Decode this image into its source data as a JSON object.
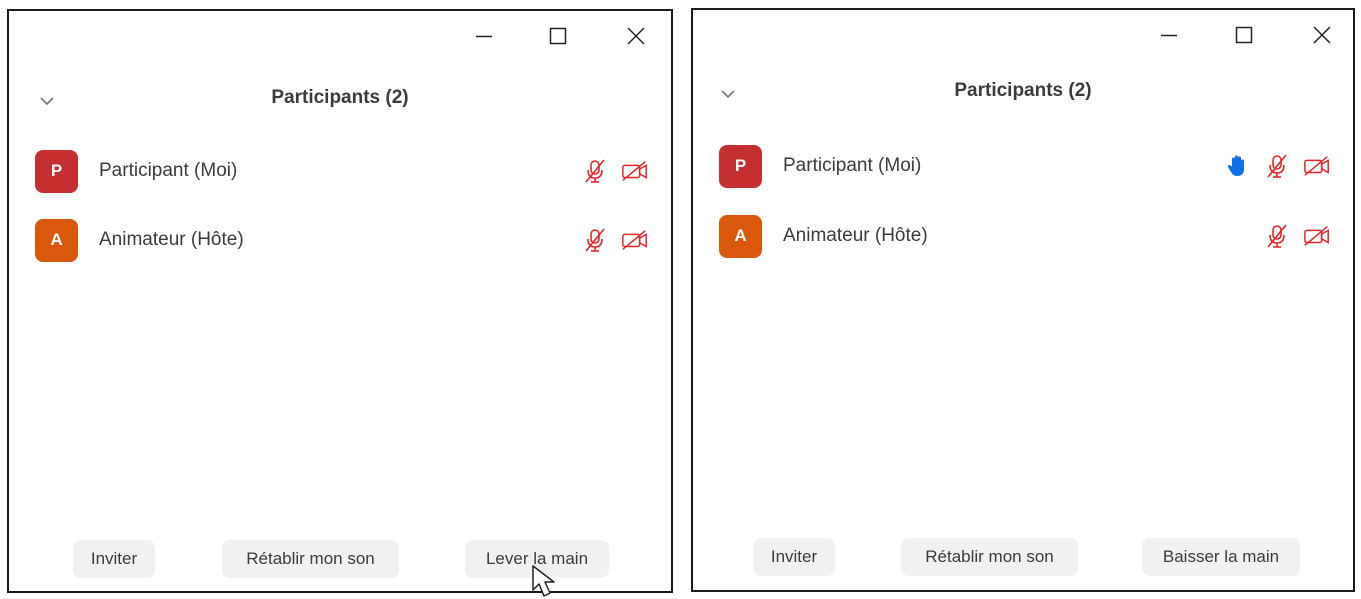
{
  "colors": {
    "avatar_p": "#c62f2f",
    "avatar_a": "#d9580c",
    "muted_icon": "#e8262a",
    "hand_icon": "#0e71eb",
    "button_bg": "#f1f1f4",
    "text": "#3b3b3b"
  },
  "panels": [
    {
      "window_controls": [
        "minimize-icon",
        "maximize-icon",
        "close-icon"
      ],
      "title": "Participants (2)",
      "participants": [
        {
          "initial": "P",
          "name": "Participant (Moi)",
          "hand_raised": false,
          "icons": [
            "mic-muted-icon",
            "video-off-icon"
          ]
        },
        {
          "initial": "A",
          "name": "Animateur (Hôte)",
          "hand_raised": false,
          "icons": [
            "mic-muted-icon",
            "video-off-icon"
          ]
        }
      ],
      "buttons": {
        "invite": "Inviter",
        "unmute": "Rétablir mon son",
        "hand": "Lever la main"
      }
    },
    {
      "window_controls": [
        "minimize-icon",
        "maximize-icon",
        "close-icon"
      ],
      "title": "Participants (2)",
      "participants": [
        {
          "initial": "P",
          "name": "Participant (Moi)",
          "hand_raised": true,
          "icons": [
            "raised-hand-icon",
            "mic-muted-icon",
            "video-off-icon"
          ]
        },
        {
          "initial": "A",
          "name": "Animateur (Hôte)",
          "hand_raised": false,
          "icons": [
            "mic-muted-icon",
            "video-off-icon"
          ]
        }
      ],
      "buttons": {
        "invite": "Inviter",
        "unmute": "Rétablir mon son",
        "hand": "Baisser la main"
      }
    }
  ]
}
